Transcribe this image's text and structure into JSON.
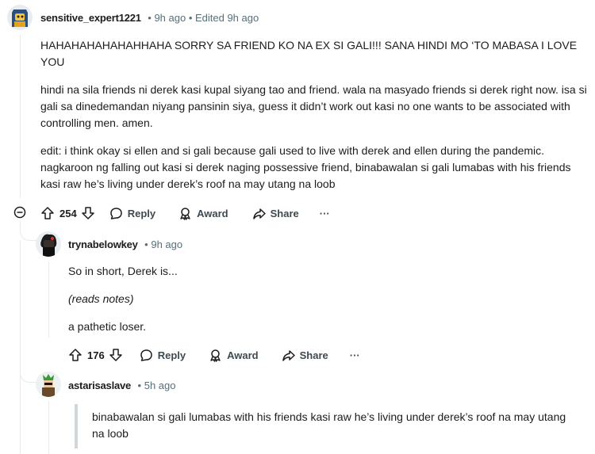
{
  "comments": [
    {
      "username": "sensitive_expert1221",
      "meta": "• 9h ago • Edited 9h ago",
      "paragraphs": [
        "HAHAHAHAHAHAHHAHA SORRY SA FRIEND KO NA EX SI GALI!!! SANA HINDI MO ‘TO MABASA I LOVE YOU",
        "hindi na sila friends ni derek kasi kupal siyang tao and friend. wala na masyado friends si derek right now. isa si gali sa dinedemandan niyang pansinin siya, guess it didn’t work out kasi no one wants to be associated with controlling men. amen.",
        "edit: i think okay si ellen and si gali because gali used to live with derek and ellen during the pandemic. nagkaroon ng falling out kasi si derek naging possessive friend, binabawalan si gali lumabas with his friends kasi raw he’s living under derek’s roof na may utang na loob"
      ],
      "votes": "254",
      "actions": {
        "reply": "Reply",
        "award": "Award",
        "share": "Share",
        "more": "···"
      }
    },
    {
      "username": "trynabelowkey",
      "meta": "• 9h ago",
      "paragraphs": [
        "So in short, Derek is...",
        "(reads notes)",
        "a pathetic loser."
      ],
      "votes": "176",
      "actions": {
        "reply": "Reply",
        "award": "Award",
        "share": "Share",
        "more": "···"
      }
    },
    {
      "username": "astarisaslave",
      "meta": "• 5h ago",
      "quote": "binabawalan si gali lumabas with his friends kasi raw he’s living under derek’s roof na may utang na loob"
    }
  ],
  "colors": {
    "text": "#1c1c1c",
    "meta": "#576f76",
    "thread": "#e5ebee",
    "quote_bar": "#d0d7da"
  }
}
